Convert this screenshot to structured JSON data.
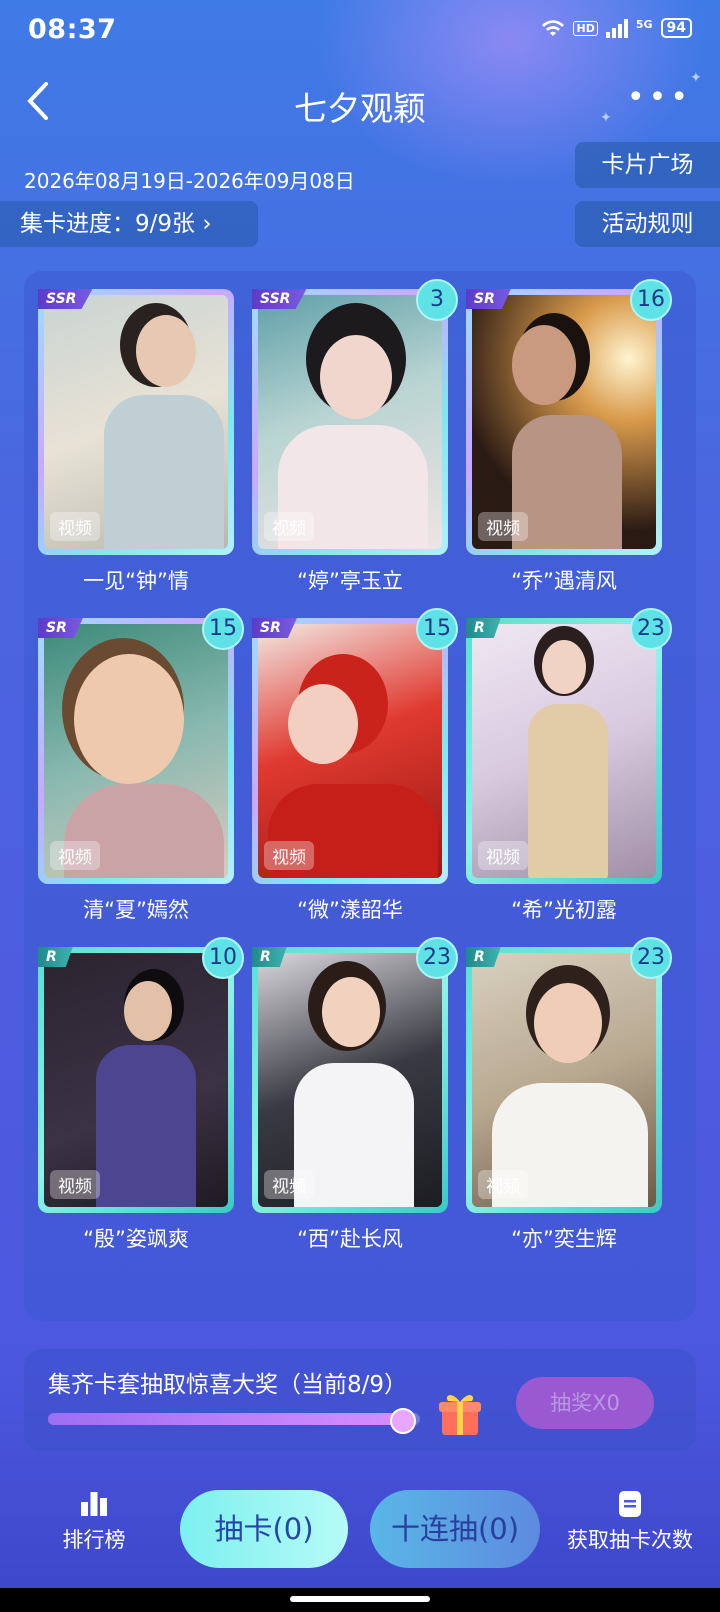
{
  "status": {
    "time": "08:37",
    "hd": "HD",
    "network": "5G",
    "battery": "94"
  },
  "header": {
    "title": "七夕观颖"
  },
  "event": {
    "date_range": "2026年08月19日-2026年09月08日",
    "progress_label": "集卡进度：9/9张",
    "card_square": "卡片广场",
    "rules": "活动规则"
  },
  "cards": [
    {
      "name": "一见“钟”情",
      "rarity": "SSR",
      "count": "",
      "tag": "视频"
    },
    {
      "name": "“婷”亭玉立",
      "rarity": "SSR",
      "count": "3",
      "tag": "视频"
    },
    {
      "name": "“乔”遇清风",
      "rarity": "SR",
      "count": "16",
      "tag": "视频"
    },
    {
      "name": "清“夏”嫣然",
      "rarity": "SR",
      "count": "15",
      "tag": "视频"
    },
    {
      "name": "“微”漾韶华",
      "rarity": "SR",
      "count": "15",
      "tag": "视频"
    },
    {
      "name": "“希”光初露",
      "rarity": "R",
      "count": "23",
      "tag": "视频"
    },
    {
      "name": "“殷”姿飒爽",
      "rarity": "R",
      "count": "10",
      "tag": "视频"
    },
    {
      "name": "“西”赴长风",
      "rarity": "R",
      "count": "23",
      "tag": "视频"
    },
    {
      "name": "“亦”奕生辉",
      "rarity": "R",
      "count": "23",
      "tag": "视频"
    }
  ],
  "prize": {
    "text": "集齐卡套抽取惊喜大奖（当前8/9）",
    "progress": 0.95,
    "button": "抽奖X0"
  },
  "bottom": {
    "ranking": "排行榜",
    "draw": "抽卡(0)",
    "ten_draw": "十连抽(0)",
    "get_draws": "获取抽卡次数"
  }
}
